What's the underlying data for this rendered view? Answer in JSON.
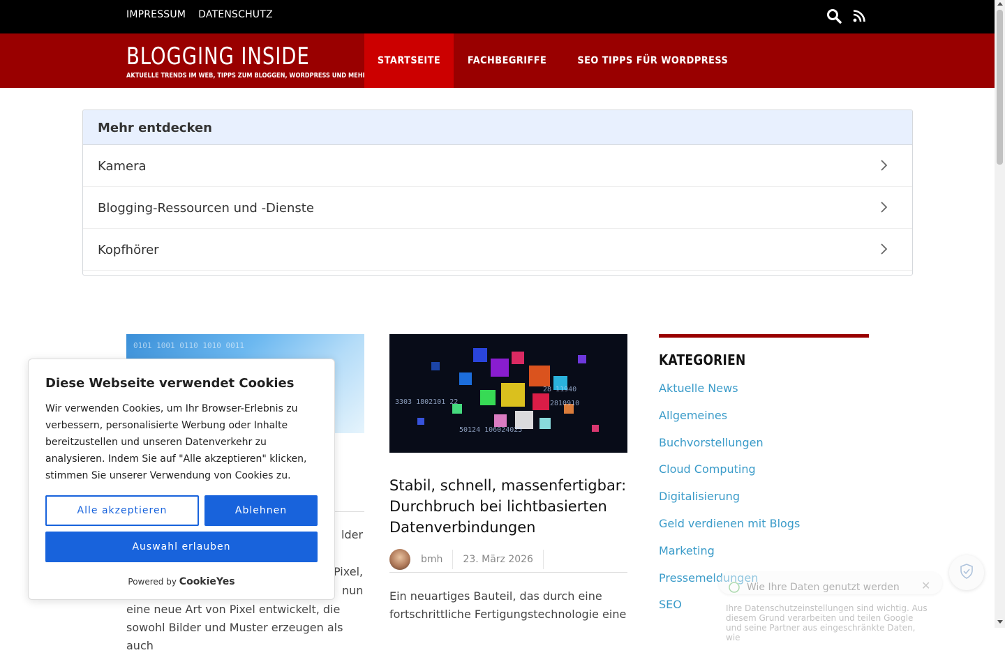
{
  "topbar": {
    "links": [
      "IMPRESSUM",
      "DATENSCHUTZ"
    ],
    "icons": [
      "search-icon",
      "rss-icon"
    ]
  },
  "header": {
    "title": "BLOGGING INSIDE",
    "tagline": "AKTUELLE TRENDS IM WEB, TIPPS ZUM BLOGGEN, WORDPRESS UND MEHR",
    "nav": [
      "STARTSEITE",
      "FACHBEGRIFFE",
      "SEO TIPPS FÜR WORDPRESS"
    ],
    "active_nav": "STARTSEITE"
  },
  "discover": {
    "heading": "Mehr entdecken",
    "items": [
      "Kamera",
      "Blogging-Ressourcen und -Dienste",
      "Kopfhörer"
    ]
  },
  "posts": {
    "left": {
      "excerpt_partial": [
        "lder",
        "Pixel,",
        "nun"
      ],
      "excerpt_lines": [
        "eine neue Art von Pixel entwickelt, die",
        "sowohl Bilder und Muster erzeugen als auch"
      ]
    },
    "right": {
      "title": "Stabil, schnell, massenfertigbar: Durchbruch bei lichtbasierten Datenverbindungen",
      "author": "bmh",
      "date": "23. März 2026",
      "excerpt": "Ein neuartiges Bauteil, das durch eine fortschrittliche Fertigungstechnologie eine"
    }
  },
  "sidebar": {
    "title": "KATEGORIEN",
    "categories": [
      "Aktuelle News",
      "Allgemeines",
      "Buchvorstellungen",
      "Cloud Computing",
      "Digitalisierung",
      "Geld verdienen mit Blogs",
      "Marketing",
      "Pressemeldungen",
      "SEO"
    ]
  },
  "cookie": {
    "title": "Diese Webseite verwendet Cookies",
    "text": "Wir verwenden Cookies, um Ihr Browser-Erlebnis zu verbessern, personalisierte Werbung oder Inhalte bereitzustellen und unseren Datenverkehr zu analysieren. Indem Sie auf \"Alle akzeptieren\" klicken, stimmen Sie unserer Verwendung von Cookies zu.",
    "accept_all": "Alle akzeptieren",
    "reject": "Ablehnen",
    "allow_selection": "Auswahl erlauben",
    "powered_by": "Powered by",
    "brand": "CookieYes"
  },
  "privacy_popup": {
    "heading": "Wie Ihre Daten genutzt werden",
    "body": "Ihre Datenschutzeinstellungen sind wichtig. Aus diesem Grund verarbeiten und teilen Google und seine Partner aus eingeschränkte Daten, wie"
  },
  "colors": {
    "brand_red": "#990000",
    "active_red": "#cc0000",
    "link_blue": "#3a9bc9",
    "cookie_blue": "#1863dc"
  }
}
